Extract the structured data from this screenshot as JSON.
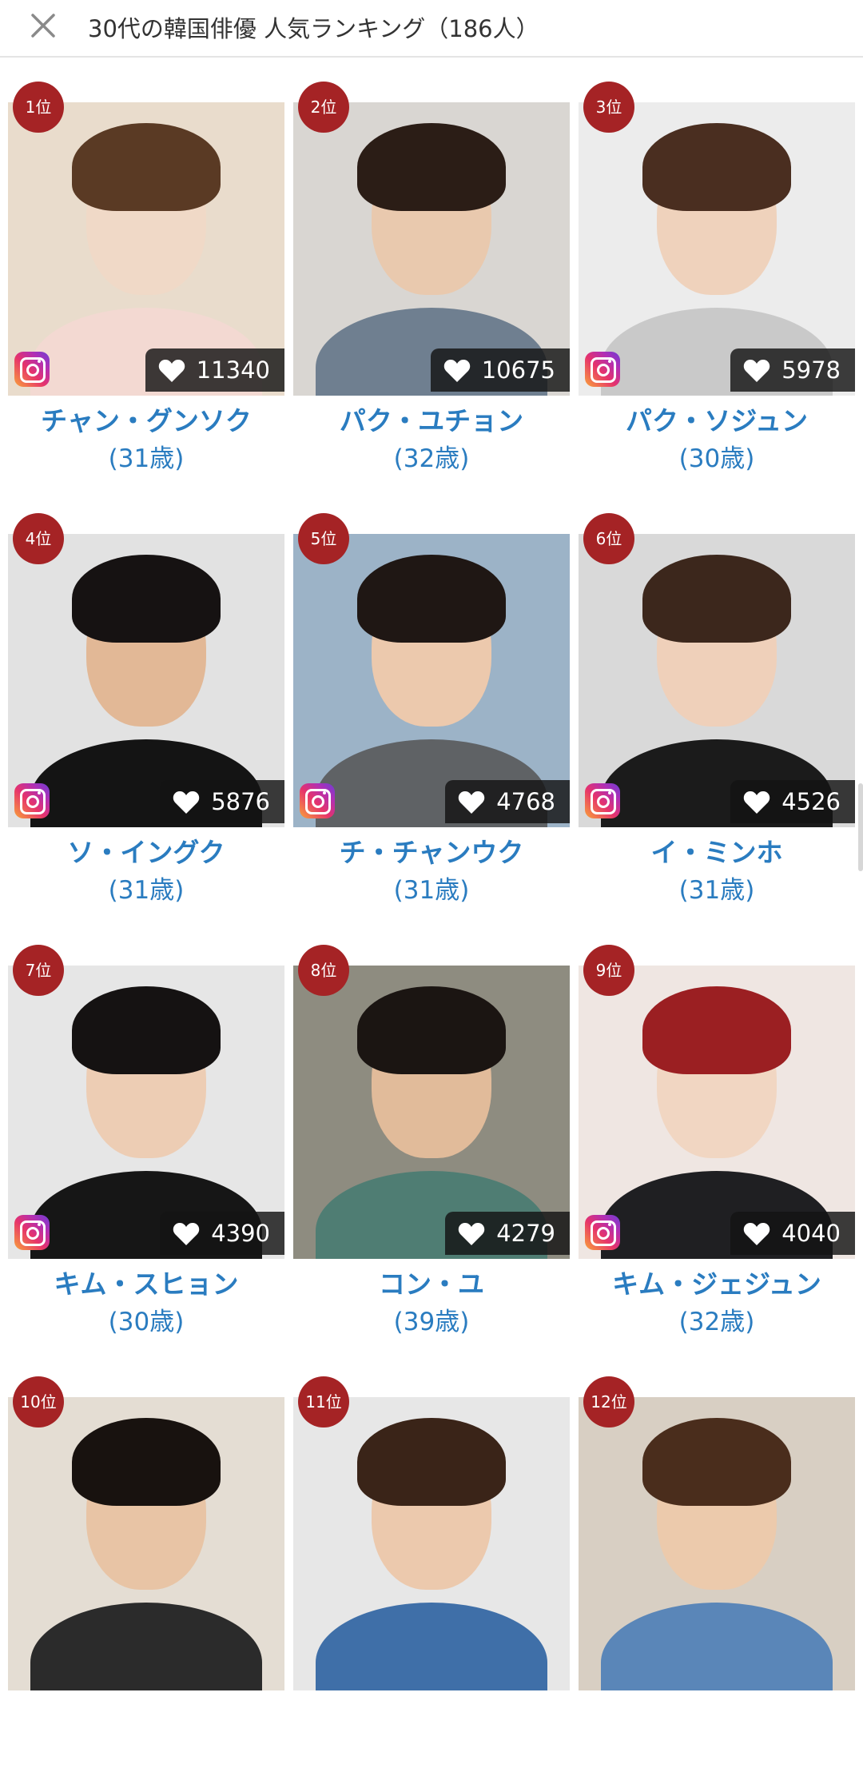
{
  "header": {
    "close_icon": "close-icon",
    "title": "30代の韓国俳優 人気ランキング（186人）"
  },
  "cards": [
    {
      "rank": "1位",
      "likes": "11340",
      "name": "チャン・グンソク",
      "age": "(31歳)",
      "instagram": true,
      "bg": "#e9dccc",
      "skin": "#f0d9c7",
      "hair": "#5a3a24",
      "cloth": "#f3d9d2"
    },
    {
      "rank": "2位",
      "likes": "10675",
      "name": "パク・ユチョン",
      "age": "(32歳)",
      "instagram": false,
      "bg": "#d9d6d2",
      "skin": "#e9c9ae",
      "hair": "#2b1d16",
      "cloth": "#6f7f90"
    },
    {
      "rank": "3位",
      "likes": "5978",
      "name": "パク・ソジュン",
      "age": "(30歳)",
      "instagram": true,
      "bg": "#ececec",
      "skin": "#efd2bc",
      "hair": "#4a2e20",
      "cloth": "#c9c9c9"
    },
    {
      "rank": "4位",
      "likes": "5876",
      "name": "ソ・イングク",
      "age": "(31歳)",
      "instagram": true,
      "bg": "#e2e2e2",
      "skin": "#e2b896",
      "hair": "#161212",
      "cloth": "#141414"
    },
    {
      "rank": "5位",
      "likes": "4768",
      "name": "チ・チャンウク",
      "age": "(31歳)",
      "instagram": true,
      "bg": "#9cb3c7",
      "skin": "#ecc9ad",
      "hair": "#1f1714",
      "cloth": "#5f6265"
    },
    {
      "rank": "6位",
      "likes": "4526",
      "name": "イ・ミンホ",
      "age": "(31歳)",
      "instagram": true,
      "bg": "#d9d9d9",
      "skin": "#efd0ba",
      "hair": "#3c271c",
      "cloth": "#1b1b1b"
    },
    {
      "rank": "7位",
      "likes": "4390",
      "name": "キム・スヒョン",
      "age": "(30歳)",
      "instagram": true,
      "bg": "#e6e6e6",
      "skin": "#edcdb4",
      "hair": "#151212",
      "cloth": "#161616"
    },
    {
      "rank": "8位",
      "likes": "4279",
      "name": "コン・ユ",
      "age": "(39歳)",
      "instagram": false,
      "bg": "#8e8c80",
      "skin": "#e1bb9a",
      "hair": "#1b1512",
      "cloth": "#4f7d73"
    },
    {
      "rank": "9位",
      "likes": "4040",
      "name": "キム・ジェジュン",
      "age": "(32歳)",
      "instagram": true,
      "bg": "#efe6e2",
      "skin": "#f1d6c2",
      "hair": "#9b1f22",
      "cloth": "#1f1f22"
    },
    {
      "rank": "10位",
      "likes": "",
      "name": "",
      "age": "",
      "instagram": false,
      "bg": "#e4ddd3",
      "skin": "#e8c4a5",
      "hair": "#18120f",
      "cloth": "#2b2b2b"
    },
    {
      "rank": "11位",
      "likes": "",
      "name": "",
      "age": "",
      "instagram": false,
      "bg": "#e7e7e7",
      "skin": "#ecc9ad",
      "hair": "#3a2418",
      "cloth": "#3f6fa8"
    },
    {
      "rank": "12位",
      "likes": "",
      "name": "",
      "age": "",
      "instagram": false,
      "bg": "#d8cfc3",
      "skin": "#eccaac",
      "hair": "#4a2d1c",
      "cloth": "#5a86b8"
    }
  ],
  "icons": {
    "heart": "heart-icon",
    "instagram": "instagram-icon"
  }
}
